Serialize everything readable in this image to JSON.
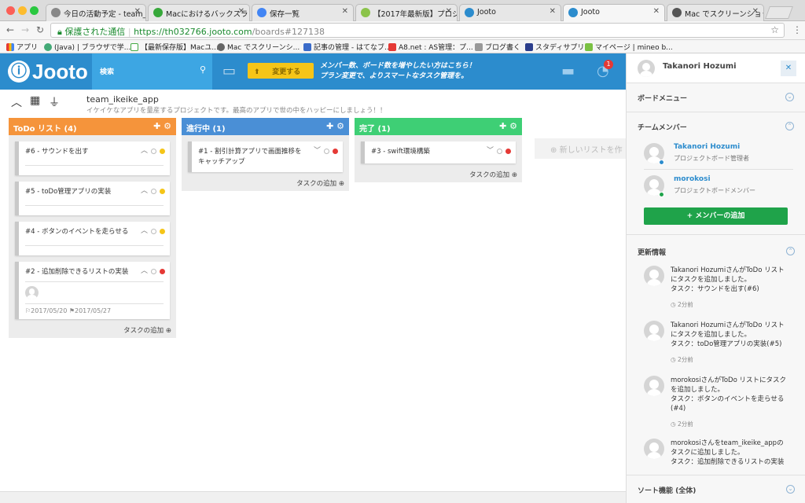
{
  "browser": {
    "tabs": [
      {
        "title": "今日の活動予定 - team_i",
        "color": "#888888"
      },
      {
        "title": "Macにおけるバックスラ",
        "color": "#37a83a"
      },
      {
        "title": "保存一覧",
        "color": "#4285f4"
      },
      {
        "title": "【2017年最新版】プロジ",
        "color": "#8bc34a"
      },
      {
        "title": "Jooto",
        "color": "#2c8ccd"
      },
      {
        "title": "Jooto",
        "color": "#2c8ccd"
      },
      {
        "title": "Mac でスクリーンショッ",
        "color": "#555555"
      }
    ],
    "secure_label": "保護された通信",
    "url_host": "https://th032766.jooto.com",
    "url_path": "/boards#127138",
    "bookmarks": [
      "アプリ",
      "(Java) | ブラウザで学...",
      "【最新保存版】Macユ...",
      "Mac でスクリーンシ...",
      "記事の管理 - はてなブ...",
      "A8.net : AS管理：プ...",
      "ブログ書く",
      "スタディサプリ",
      "マイページ | mineo b..."
    ]
  },
  "app": {
    "logo": "Jooto",
    "search_label": "検索",
    "change_button": "変更する",
    "promo_line1": "メンバー数、ボード数を増やしたい方はこちら！",
    "promo_line2": "プラン変更で、よりスマートなタスク管理を。",
    "notif_count": "1"
  },
  "board": {
    "name": "team_ikeike_app",
    "description": "イケイケなアプリを量産するプロジェクトです。最高のアプリで世の中をハッピーにしましょう！！",
    "add_task_label": "タスクの追加",
    "new_list_label": "新しいリストを作",
    "lists": [
      {
        "title": "ToDo リスト (4)",
        "color": "#f5943b",
        "cards": [
          {
            "title": "#6 - サウンドを出す",
            "status": "#f5c518"
          },
          {
            "title": "#5 - toDo管理アプリの実装",
            "status": "#f5c518"
          },
          {
            "title": "#4 - ボタンのイベントを走らせる",
            "status": "#f5c518"
          },
          {
            "title": "#2 - 追加削除できるリストの実装",
            "status": "#e53935",
            "start": "2017/05/20",
            "end": "2017/05/27"
          }
        ]
      },
      {
        "title": "進行中 (1)",
        "color": "#4a8fd6",
        "cards": [
          {
            "title": "#1 - 割引計算アプリで画面推移をキャッチアップ",
            "status": "#e53935"
          }
        ]
      },
      {
        "title": "完了 (1)",
        "color": "#3ecf75",
        "cards": [
          {
            "title": "#3 - swift環境構築",
            "status": "#e53935"
          }
        ]
      }
    ]
  },
  "sidebar": {
    "user": "Takanori Hozumi",
    "board_menu": "ボードメニュー",
    "team_members": "チームメンバー",
    "members": [
      {
        "name": "Takanori Hozumi",
        "role": "プロジェクトボード管理者",
        "status": "#2c8ccd"
      },
      {
        "name": "morokosi",
        "role": "プロジェクトボードメンバー",
        "status": "#1fa34a"
      }
    ],
    "add_member": "+ メンバーの追加",
    "updates_title": "更新情報",
    "updates": [
      {
        "l1": "Takanori HozumiさんがToDo リスト",
        "l2": "にタスクを追加しました。",
        "l3": "タスク：サウンドを出す(#6)",
        "l4": "",
        "time": "2分前"
      },
      {
        "l1": "Takanori HozumiさんがToDo リスト",
        "l2": "にタスクを追加しました。",
        "l3": "タスク：toDo管理アプリの実装(#5)",
        "l4": "",
        "time": "2分前"
      },
      {
        "l1": "morokosiさんがToDo リストにタスク",
        "l2": "を追加しました。",
        "l3": "タスク：ボタンのイベントを走らせる",
        "l4": "(#4)",
        "time": "2分前"
      },
      {
        "l1": "morokosiさんをteam_ikeike_appの",
        "l2": "タスクに追加しました。",
        "l3": "タスク：追加削除できるリストの実装",
        "l4": "",
        "time": ""
      }
    ],
    "sort_label": "ソート機能 (全体)"
  }
}
